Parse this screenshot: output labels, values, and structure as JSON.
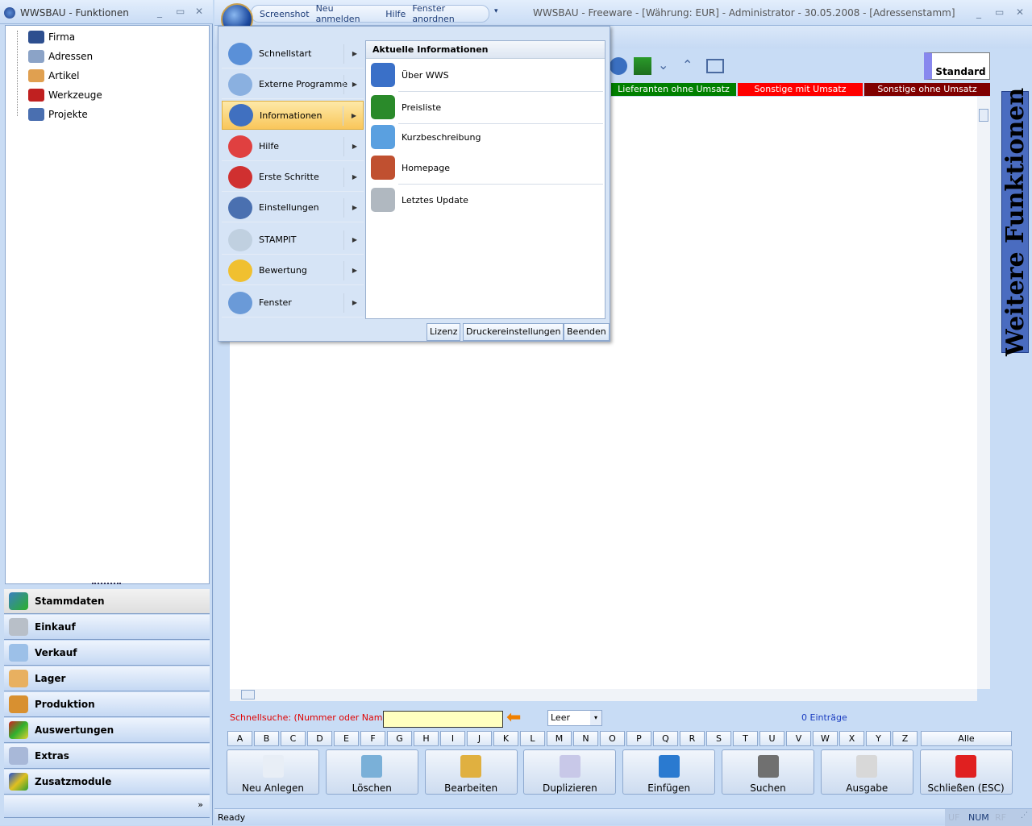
{
  "left_window": {
    "title": "WWSBAU - Funktionen",
    "tree": [
      "Firma",
      "Adressen",
      "Artikel",
      "Werkzeuge",
      "Projekte"
    ],
    "nav": [
      "Stammdaten",
      "Einkauf",
      "Verkauf",
      "Lager",
      "Produktion",
      "Auswertungen",
      "Extras",
      "Zusatzmodule"
    ],
    "more": "»"
  },
  "main_window": {
    "quick_access": [
      "Screenshot",
      "Neu anmelden",
      "Hilfe",
      "Fenster anordnen"
    ],
    "title": "WWSBAU - Freeware - [Währung: EUR] - Administrator - 30.05.2008 - [Adressenstamm]",
    "standard_button": "Standard",
    "tabs": [
      {
        "label": "Lieferanten ohne Umsatz",
        "color": "#008000"
      },
      {
        "label": "Sonstige mit Umsatz",
        "color": "#ff0000"
      },
      {
        "label": "Sonstige ohne Umsatz",
        "color": "#800000"
      }
    ],
    "side_panel": "Weitere Funktionen",
    "search": {
      "label": "Schnellsuche: (Nummer oder Name) :",
      "value": "",
      "filter": "Leer",
      "count": "0 Einträge"
    },
    "letters": [
      "A",
      "B",
      "C",
      "D",
      "E",
      "F",
      "G",
      "H",
      "I",
      "J",
      "K",
      "L",
      "M",
      "N",
      "O",
      "P",
      "Q",
      "R",
      "S",
      "T",
      "U",
      "V",
      "W",
      "X",
      "Y",
      "Z"
    ],
    "all": "Alle",
    "actions": [
      "Neu Anlegen",
      "Löschen",
      "Bearbeiten",
      "Duplizieren",
      "Einfügen",
      "Suchen",
      "Ausgabe",
      "Schließen (ESC)"
    ],
    "status": {
      "text": "Ready",
      "uf": "UF",
      "num": "NUM",
      "rf": "RF"
    }
  },
  "menu": {
    "items": [
      "Schnellstart",
      "Externe Programme",
      "Informationen",
      "Hilfe",
      "Erste Schritte",
      "Einstellungen",
      "STAMPIT",
      "Bewertung",
      "Fenster"
    ],
    "active": "Informationen",
    "submenu_title": "Aktuelle Informationen",
    "submenu": [
      "Über WWS",
      "Preisliste",
      "Kurzbeschreibung",
      "Homepage",
      "Letztes Update"
    ],
    "buttons": [
      "Lizenz",
      "Druckereinstellungen",
      "Beenden"
    ]
  }
}
